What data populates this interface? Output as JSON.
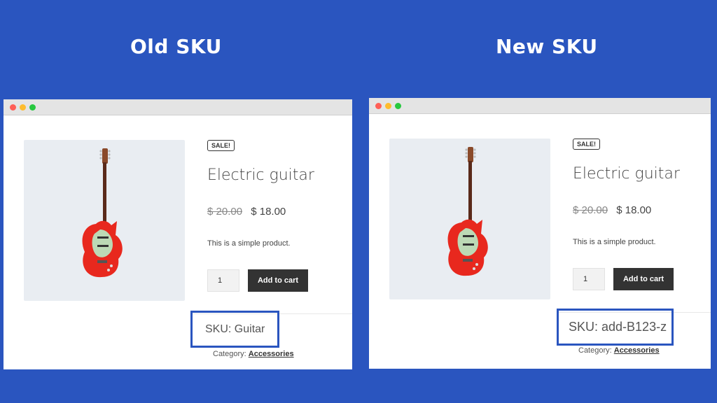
{
  "headings": {
    "left": "Old SKU",
    "right": "New SKU"
  },
  "left_window": {
    "sale_badge": "SALE!",
    "title": "Electric guitar",
    "old_price": "$ 20.00",
    "price": "$ 18.00",
    "description": "This is a simple product.",
    "quantity": "1",
    "add_to_cart": "Add to cart",
    "sku": "SKU: Guitar",
    "category_label": "Category:",
    "category_link": "Accessories"
  },
  "right_window": {
    "sale_badge": "SALE!",
    "title": "Electric guitar",
    "old_price": "$ 20.00",
    "price": "$ 18.00",
    "description": "This is a simple product.",
    "quantity": "1",
    "add_to_cart": "Add to cart",
    "sku": "SKU: add-B123-z",
    "category_label": "Category:",
    "category_link": "Accessories"
  },
  "colors": {
    "background": "#2a55bf",
    "button": "#333333",
    "highlight": "#2a55bf",
    "guitar_body": "#e8281e"
  }
}
